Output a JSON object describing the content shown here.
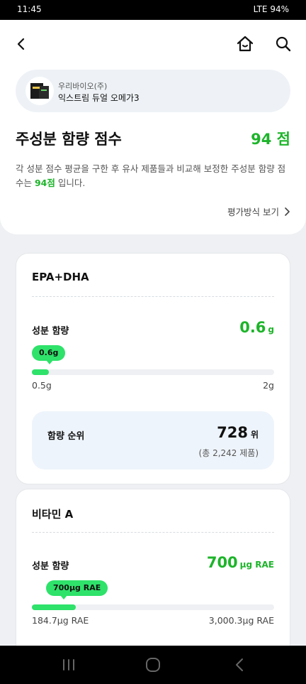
{
  "status_bar": {
    "time": "11:45",
    "right": "LTE 94%"
  },
  "product": {
    "brand": "우리바이오(주)",
    "name": "익스트림 듀얼 오메가3"
  },
  "score": {
    "title": "주성분 함량 점수",
    "value": "94 점",
    "desc_prefix": "각 성분 점수 평균을 구한 후 유사 제품들과 비교해 보정한 주성분 함량 점수는 ",
    "desc_highlight": "94점",
    "desc_suffix": " 입니다."
  },
  "eval_link": "평가방식 보기",
  "nutrients": [
    {
      "title": "EPA+DHA",
      "amount_label": "성분 함량",
      "amount_value": "0.6",
      "amount_unit": "g",
      "tooltip": "0.6g",
      "range_min": "0.5g",
      "range_max": "2g",
      "fill_fraction": 0.07,
      "rank_label": "함량 순위",
      "rank_value": "728",
      "rank_unit": "위",
      "rank_total": "(총 2,242 제품)"
    },
    {
      "title": "비타민 A",
      "amount_label": "성분 함량",
      "amount_value": "700",
      "amount_unit": "μg RAE",
      "tooltip": "700μg RAE",
      "range_min": "184.7μg RAE",
      "range_max": "3,000.3μg RAE",
      "fill_fraction": 0.18
    }
  ],
  "colors": {
    "accent": "#1db42a",
    "bar": "#2ee26a",
    "pill_bg": "#eef2f6",
    "rank_bg": "#eef4fb"
  },
  "icons": {
    "back": "chevron-left-icon",
    "home": "home-icon",
    "search": "search-icon"
  }
}
